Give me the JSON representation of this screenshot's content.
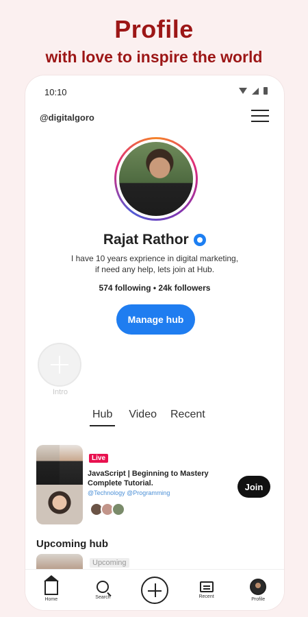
{
  "promo": {
    "title": "Profile",
    "subtitle": "with love to inspire the world"
  },
  "status_bar": {
    "time": "10:10"
  },
  "header": {
    "handle": "@digitalgoro"
  },
  "profile": {
    "name": "Rajat Rathor",
    "bio_line1": "I have 10 years exprience in digital marketing,",
    "bio_line2": "if need any help, lets join at Hub.",
    "stats": "574 following • 24k followers",
    "manage_label": "Manage hub"
  },
  "intro": {
    "label": "Intro"
  },
  "tabs": [
    {
      "label": "Hub",
      "active": true
    },
    {
      "label": "Video",
      "active": false
    },
    {
      "label": "Recent",
      "active": false
    }
  ],
  "hub_card": {
    "badge": "Live",
    "title_line1": "JavaScript | Beginning to Mastery",
    "title_line2": "Complete Tutorial.",
    "tags": "@Technology @Programming",
    "join_label": "Join"
  },
  "upcoming": {
    "title": "Upcoming hub",
    "badge": "Upcoming"
  },
  "bottom_nav": [
    {
      "label": "Home",
      "icon": "home-icon"
    },
    {
      "label": "Search",
      "icon": "search-icon"
    },
    {
      "label": "",
      "icon": "add-icon"
    },
    {
      "label": "Recent",
      "icon": "recent-icon"
    },
    {
      "label": "Profile",
      "icon": "profile-icon"
    }
  ],
  "colors": {
    "brand": "#9c1616",
    "primary_button": "#1f7df0",
    "live_badge": "#e8114f",
    "verified": "#1d7ff2"
  }
}
